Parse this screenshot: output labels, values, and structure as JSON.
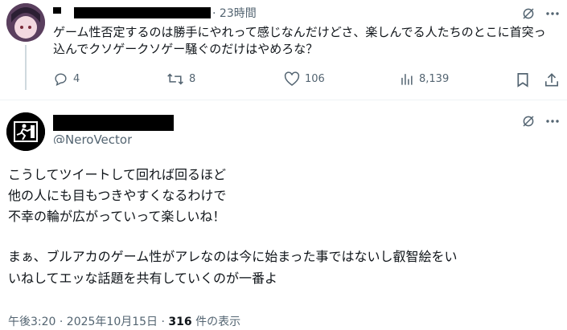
{
  "reply": {
    "display_name_redacted": true,
    "time_label": "23時間",
    "text": "ゲーム性否定するのは勝手にやれって感じなんだけどさ、楽しんでる人たちのとこに首突っ込んでクソゲークソゲー騒ぐのだけはやめろな？",
    "metrics": {
      "replies": "4",
      "reposts": "8",
      "likes": "106",
      "views": "8,139"
    },
    "icons": [
      "grok-icon",
      "more-icon",
      "reply-icon",
      "repost-icon",
      "like-icon",
      "views-icon",
      "bookmark-icon",
      "share-icon"
    ]
  },
  "main": {
    "handle": "@NeroVector",
    "display_name_redacted": true,
    "text_lines": [
      "こうしてツイートして回れば回るほど",
      "他の人にも目もつきやすくなるわけで",
      "不幸の輪が広がっていって楽しいね！",
      "",
      "まぁ、ブルアカのゲーム性がアレなのは今に始まった事ではないし叡智絵をい",
      "いねしてエッな話題を共有していくのが一番よ"
    ],
    "timestamp": "午後3:20 · 2025年10月15日",
    "view_count": "316",
    "view_suffix": " 件の表示",
    "icons": [
      "grok-icon",
      "more-icon"
    ]
  },
  "colors": {
    "text": "#0f1419",
    "muted": "#536471",
    "border": "#eff3f4"
  }
}
